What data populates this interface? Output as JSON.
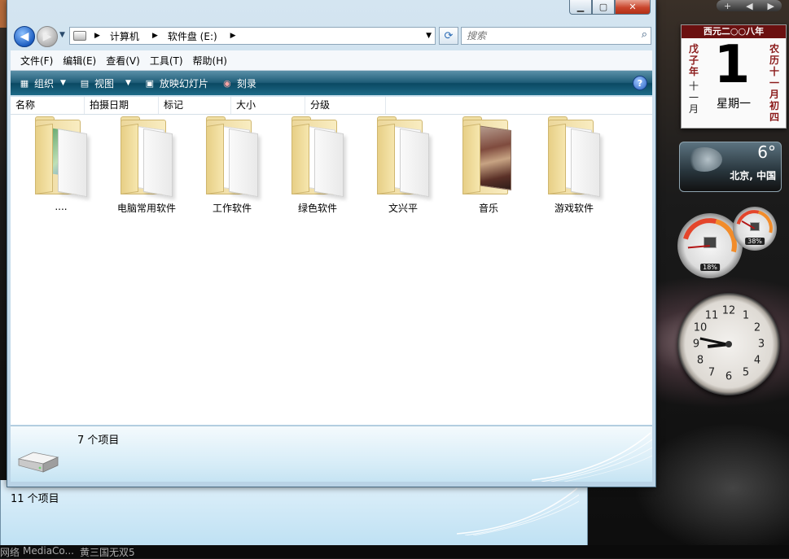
{
  "address_bar": {
    "crumbs": [
      "计算机",
      "软件盘 (E:)"
    ]
  },
  "search": {
    "placeholder": "搜索"
  },
  "menu": [
    "文件(F)",
    "编辑(E)",
    "查看(V)",
    "工具(T)",
    "帮助(H)"
  ],
  "toolbar": {
    "organize": "组织",
    "views": "视图",
    "slideshow": "放映幻灯片",
    "burn": "刻录"
  },
  "columns": [
    "名称",
    "拍摄日期",
    "标记",
    "大小",
    "分级"
  ],
  "folders": [
    {
      "name": "....",
      "style": "green"
    },
    {
      "name": "电脑常用软件",
      "style": "plain"
    },
    {
      "name": "工作软件",
      "style": "plain"
    },
    {
      "name": "绿色软件",
      "style": "plain"
    },
    {
      "name": "文兴平",
      "style": "plain"
    },
    {
      "name": "音乐",
      "style": "photo"
    },
    {
      "name": "游戏软件",
      "style": "plain"
    }
  ],
  "details_pane": {
    "item_count": "7 个项目"
  },
  "background_window": {
    "status": "11 个项目"
  },
  "taskbar": {
    "items": [
      "网络",
      "MediaCo...",
      "黄三国无双5"
    ]
  },
  "gadgets": {
    "calendar": {
      "header": "西元二○○八年",
      "left_top": [
        "戊",
        "子",
        "年"
      ],
      "left_bottom": [
        "十",
        "一",
        "月"
      ],
      "day": "1",
      "weekday": "星期一",
      "lunar": [
        "农",
        "历",
        "十",
        "一",
        "月",
        "初",
        "四"
      ]
    },
    "weather": {
      "temperature": "6°",
      "city": "北京, 中国"
    },
    "meters": {
      "cpu": "18%",
      "memory": "38%"
    },
    "clock": {
      "numbers": [
        "12",
        "1",
        "2",
        "3",
        "4",
        "5",
        "6",
        "7",
        "8",
        "9",
        "10",
        "11"
      ],
      "time": "8:47"
    }
  }
}
